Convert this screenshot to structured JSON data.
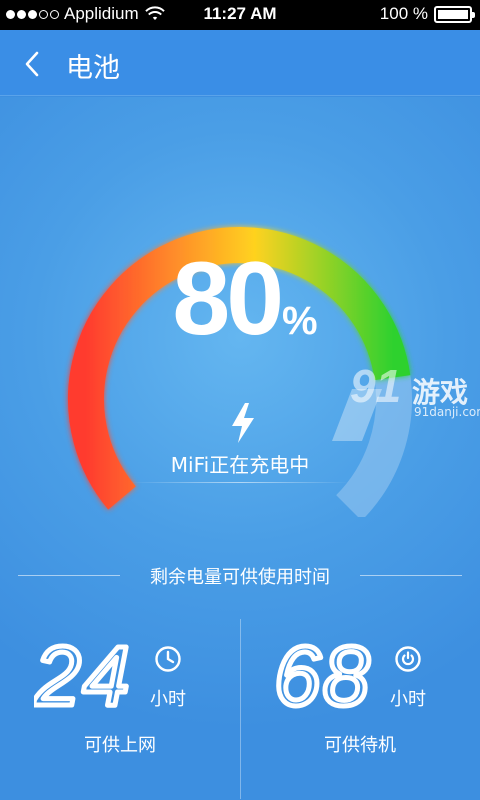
{
  "status_bar": {
    "carrier": "Applidium",
    "time": "11:27 AM",
    "battery_text": "100 %",
    "battery_level": 1.0
  },
  "header": {
    "title": "电池",
    "back_icon": "chevron-left-icon"
  },
  "gauge": {
    "value_number": "80",
    "value_unit": "%",
    "charge_level": 0.8,
    "status_text": "MiFi正在充电中",
    "status_icon": "lightning-bolt-icon",
    "colors": {
      "low": "#ff3b2f",
      "mid": "#ffd21f",
      "high": "#2fd12f",
      "remaining": "#9bc8f0"
    }
  },
  "watermark": {
    "logo_number": "91",
    "logo_name": "游戏",
    "logo_url": "91danji.com"
  },
  "remaining": {
    "section_title": "剩余电量可供使用时间",
    "stats": [
      {
        "value": "24",
        "unit": "小时",
        "caption": "可供上网",
        "icon": "clock-icon"
      },
      {
        "value": "68",
        "unit": "小时",
        "caption": "可供待机",
        "icon": "power-icon"
      }
    ]
  }
}
